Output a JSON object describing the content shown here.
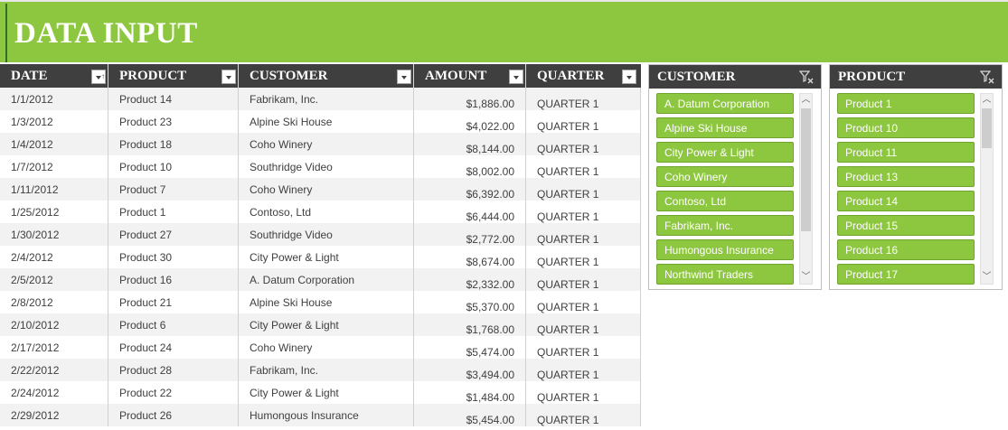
{
  "header": {
    "title": "DATA INPUT"
  },
  "table": {
    "columns": [
      {
        "label": "DATE",
        "filter_icon": "filter-sort-dropdown-icon"
      },
      {
        "label": "PRODUCT",
        "filter_icon": "filter-dropdown-icon"
      },
      {
        "label": "CUSTOMER",
        "filter_icon": "filter-dropdown-icon"
      },
      {
        "label": "AMOUNT",
        "filter_icon": "filter-dropdown-icon"
      },
      {
        "label": "QUARTER",
        "filter_icon": "filter-dropdown-icon"
      }
    ],
    "rows": [
      {
        "date": "1/1/2012",
        "product": "Product 14",
        "customer": "Fabrikam, Inc.",
        "amount": "$1,886.00",
        "quarter": "QUARTER 1"
      },
      {
        "date": "1/3/2012",
        "product": "Product 23",
        "customer": "Alpine Ski House",
        "amount": "$4,022.00",
        "quarter": "QUARTER 1"
      },
      {
        "date": "1/4/2012",
        "product": "Product 18",
        "customer": "Coho Winery",
        "amount": "$8,144.00",
        "quarter": "QUARTER 1"
      },
      {
        "date": "1/7/2012",
        "product": "Product 10",
        "customer": "Southridge Video",
        "amount": "$8,002.00",
        "quarter": "QUARTER 1"
      },
      {
        "date": "1/11/2012",
        "product": "Product 7",
        "customer": "Coho Winery",
        "amount": "$6,392.00",
        "quarter": "QUARTER 1"
      },
      {
        "date": "1/25/2012",
        "product": "Product 1",
        "customer": "Contoso, Ltd",
        "amount": "$6,444.00",
        "quarter": "QUARTER 1"
      },
      {
        "date": "1/30/2012",
        "product": "Product 27",
        "customer": "Southridge Video",
        "amount": "$2,772.00",
        "quarter": "QUARTER 1"
      },
      {
        "date": "2/4/2012",
        "product": "Product 30",
        "customer": "City Power & Light",
        "amount": "$8,674.00",
        "quarter": "QUARTER 1"
      },
      {
        "date": "2/5/2012",
        "product": "Product 16",
        "customer": "A. Datum Corporation",
        "amount": "$2,332.00",
        "quarter": "QUARTER 1"
      },
      {
        "date": "2/8/2012",
        "product": "Product 21",
        "customer": "Alpine Ski House",
        "amount": "$5,370.00",
        "quarter": "QUARTER 1"
      },
      {
        "date": "2/10/2012",
        "product": "Product 6",
        "customer": "City Power & Light",
        "amount": "$1,768.00",
        "quarter": "QUARTER 1"
      },
      {
        "date": "2/17/2012",
        "product": "Product 24",
        "customer": "Coho Winery",
        "amount": "$5,474.00",
        "quarter": "QUARTER 1"
      },
      {
        "date": "2/22/2012",
        "product": "Product 28",
        "customer": "Fabrikam, Inc.",
        "amount": "$3,494.00",
        "quarter": "QUARTER 1"
      },
      {
        "date": "2/24/2012",
        "product": "Product 22",
        "customer": "City Power & Light",
        "amount": "$1,484.00",
        "quarter": "QUARTER 1"
      },
      {
        "date": "2/29/2012",
        "product": "Product 26",
        "customer": "Humongous Insurance",
        "amount": "$5,454.00",
        "quarter": "QUARTER 1"
      }
    ]
  },
  "slicers": {
    "customer": {
      "title": "CUSTOMER",
      "clear_icon": "clear-filter-icon",
      "items": [
        "A. Datum Corporation",
        "Alpine Ski House",
        "City Power & Light",
        "Coho Winery",
        "Contoso, Ltd",
        "Fabrikam, Inc.",
        "Humongous Insurance",
        "Northwind Traders"
      ]
    },
    "product": {
      "title": "PRODUCT",
      "clear_icon": "clear-filter-icon",
      "items": [
        "Product 1",
        "Product 10",
        "Product 11",
        "Product 13",
        "Product 14",
        "Product 15",
        "Product 16",
        "Product 17"
      ]
    }
  },
  "colors": {
    "accent_green": "#8dc63f",
    "header_dark": "#3f3f3f",
    "row_alt": "#f2f2f2",
    "text": "#404040"
  }
}
